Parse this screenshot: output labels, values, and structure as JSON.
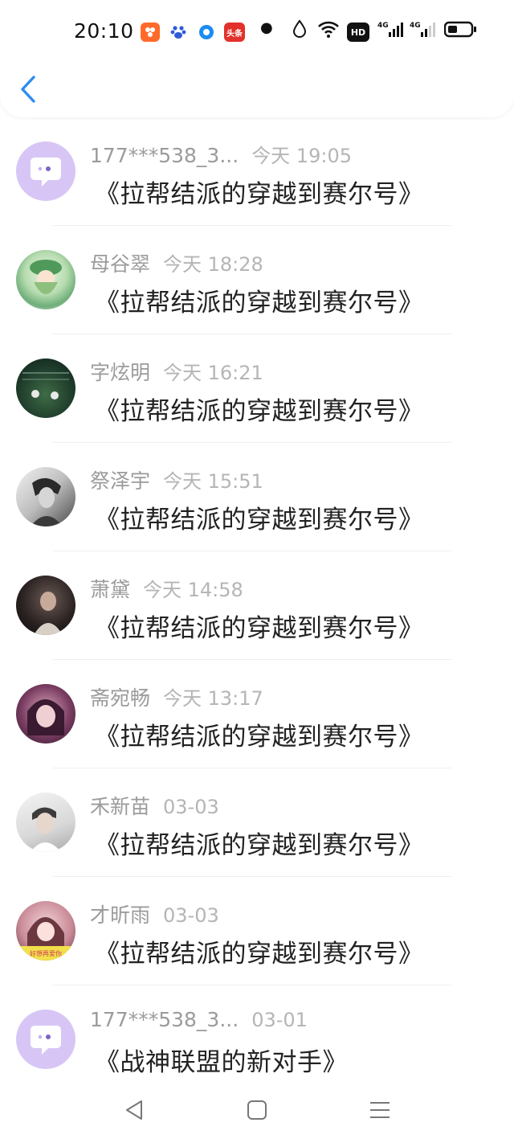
{
  "status_bar": {
    "time": "20:10",
    "notif_app_text": "头条",
    "network": "4G",
    "network2": "4G",
    "hd": "HD"
  },
  "header": {
    "back_icon": "chevron-left-icon"
  },
  "comments": [
    {
      "name": "177***538_3...",
      "time": "今天 19:05",
      "message": "《拉帮结派的穿越到赛尔号》",
      "avatar": "default-purple"
    },
    {
      "name": "母谷翠",
      "time": "今天 18:28",
      "message": "《拉帮结派的穿越到赛尔号》",
      "avatar": "anime-girl-green"
    },
    {
      "name": "字炫明",
      "time": "今天 16:21",
      "message": "《拉帮结派的穿越到赛尔号》",
      "avatar": "dark-scene"
    },
    {
      "name": "祭泽宇",
      "time": "今天 15:51",
      "message": "《拉帮结派的穿越到赛尔号》",
      "avatar": "bw-portrait"
    },
    {
      "name": "萧黛",
      "time": "今天 14:58",
      "message": "《拉帮结派的穿越到赛尔号》",
      "avatar": "dark-portrait"
    },
    {
      "name": "斋宛畅",
      "time": "今天 13:17",
      "message": "《拉帮结派的穿越到赛尔号》",
      "avatar": "purple-portrait"
    },
    {
      "name": "禾新苗",
      "time": "03-03",
      "message": "《拉帮结派的穿越到赛尔号》",
      "avatar": "light-portrait"
    },
    {
      "name": "才昕雨",
      "time": "03-03",
      "message": "《拉帮结派的穿越到赛尔号》",
      "avatar": "pink-girl"
    },
    {
      "name": "177***538_3...",
      "time": "03-01",
      "message": "《战神联盟的新对手》",
      "avatar": "default-purple"
    }
  ],
  "colors": {
    "accent": "#2f8cf3",
    "default_avatar": "#d7c6f5",
    "name_gray": "#9b9b9b",
    "time_gray": "#b5b5b5"
  },
  "avatar_badge": "好想再爱你",
  "nav": {
    "back": "triangle-back-icon",
    "home": "square-home-icon",
    "menu": "menu-lines-icon"
  }
}
